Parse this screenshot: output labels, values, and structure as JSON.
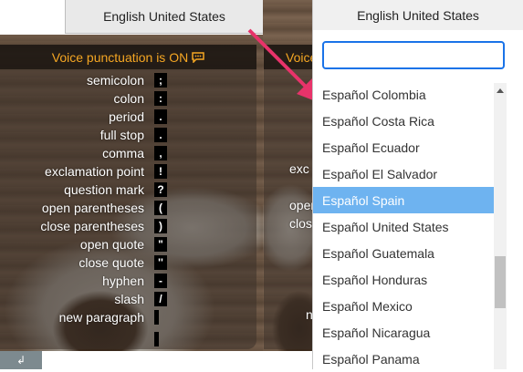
{
  "language_button": {
    "label": "English United States"
  },
  "panel": {
    "header": "Voice punctuation is ON",
    "rows": [
      {
        "label": "semicolon",
        "key": ";"
      },
      {
        "label": "colon",
        "key": ":"
      },
      {
        "label": "period",
        "key": "."
      },
      {
        "label": "full stop",
        "key": "."
      },
      {
        "label": "comma",
        "key": ","
      },
      {
        "label": "exclamation point",
        "key": "!"
      },
      {
        "label": "question mark",
        "key": "?"
      },
      {
        "label": "open parentheses",
        "key": "("
      },
      {
        "label": "close parentheses",
        "key": ")"
      },
      {
        "label": "open quote",
        "key": "\""
      },
      {
        "label": "close quote",
        "key": "''"
      },
      {
        "label": "hyphen",
        "key": "-"
      },
      {
        "label": "slash",
        "key": "/"
      },
      {
        "label": "new paragraph",
        "key": ""
      }
    ]
  },
  "panel2": {
    "header": "Voice punctuation is ON",
    "labels": [
      "exc",
      "open",
      "close",
      "n"
    ]
  },
  "dropdown": {
    "header": "English United States",
    "search_value": "",
    "items": [
      "Español Colombia",
      "Español Costa Rica",
      "Español Ecuador",
      "Español El Salvador",
      "Español Spain",
      "Español United States",
      "Español Guatemala",
      "Español Honduras",
      "Español Mexico",
      "Español Nicaragua",
      "Español Panama"
    ],
    "selected_index": 4
  },
  "colors": {
    "accent": "#f5a623",
    "selected": "#6eb3f0",
    "focus": "#1a73e8",
    "arrow": "#e8336a"
  }
}
